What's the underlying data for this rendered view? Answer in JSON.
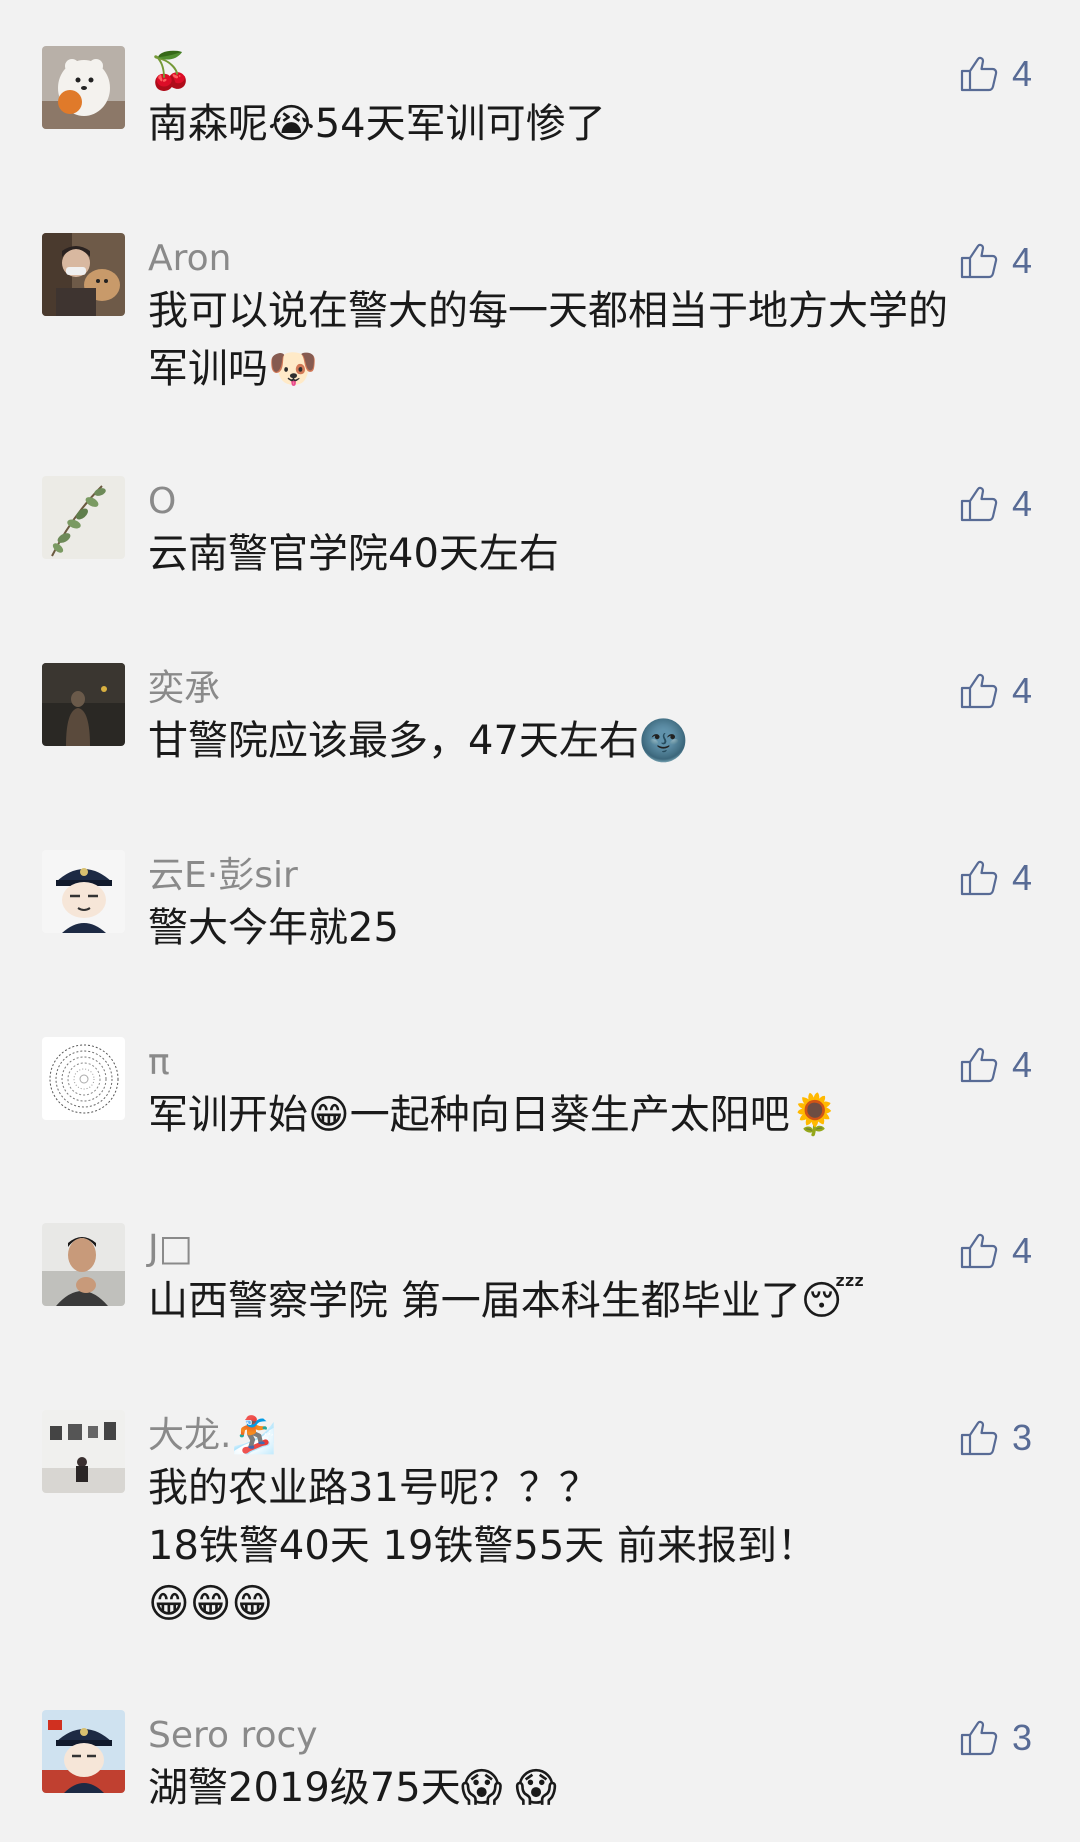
{
  "colors": {
    "background": "#f2f2f2",
    "name": "#8a8a8a",
    "like": "#586b95",
    "text": "#1a1a1a"
  },
  "comments": [
    {
      "name": "🍒",
      "likes": "4",
      "lines": [
        "南森呢😭54天军训可惨了"
      ]
    },
    {
      "name": "Aron",
      "likes": "4",
      "lines": [
        "我可以说在警大的每一天都相当于地方大学的",
        "军训吗🐶"
      ]
    },
    {
      "name": "O",
      "likes": "4",
      "lines": [
        "云南警官学院40天左右"
      ]
    },
    {
      "name": "奕承",
      "likes": "4",
      "lines": [
        "甘警院应该最多，47天左右🌚"
      ]
    },
    {
      "name": "云E·彭sir",
      "likes": "4",
      "lines": [
        "警大今年就25"
      ]
    },
    {
      "name": "π",
      "likes": "4",
      "lines": [
        "军训开始😁一起种向日葵生产太阳吧🌻"
      ]
    },
    {
      "name": "J□",
      "likes": "4",
      "lines": [
        "山西警察学院  第一届本科生都毕业了😴"
      ]
    },
    {
      "name": "大龙.🏂",
      "likes": "3",
      "lines": [
        "我的农业路31号呢？？？",
        "18铁警40天 19铁警55天 前来报到！",
        "😁😁😁"
      ]
    },
    {
      "name": "Sero rocy",
      "likes": "3",
      "lines": [
        "湖警2019级75天😱 😱"
      ]
    }
  ]
}
